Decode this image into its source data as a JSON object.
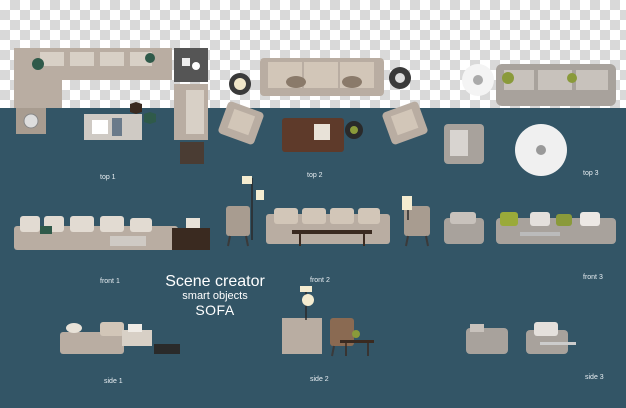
{
  "labels": {
    "top1": "top 1",
    "top2": "top 2",
    "top3": "top 3",
    "front1": "front 1",
    "front2": "front 2",
    "front3": "front 3",
    "side1": "side 1",
    "side2": "side 2",
    "side3": "side 3"
  },
  "title": {
    "line1": "Scene creator",
    "line2": "smart objects",
    "line3": "SOFA"
  },
  "colors": {
    "panel": "#335566",
    "sofa": "#b9ada2",
    "cushion": "#d8d0c6",
    "wood": "#6b4a35",
    "accent_green": "#8a9a3a"
  }
}
